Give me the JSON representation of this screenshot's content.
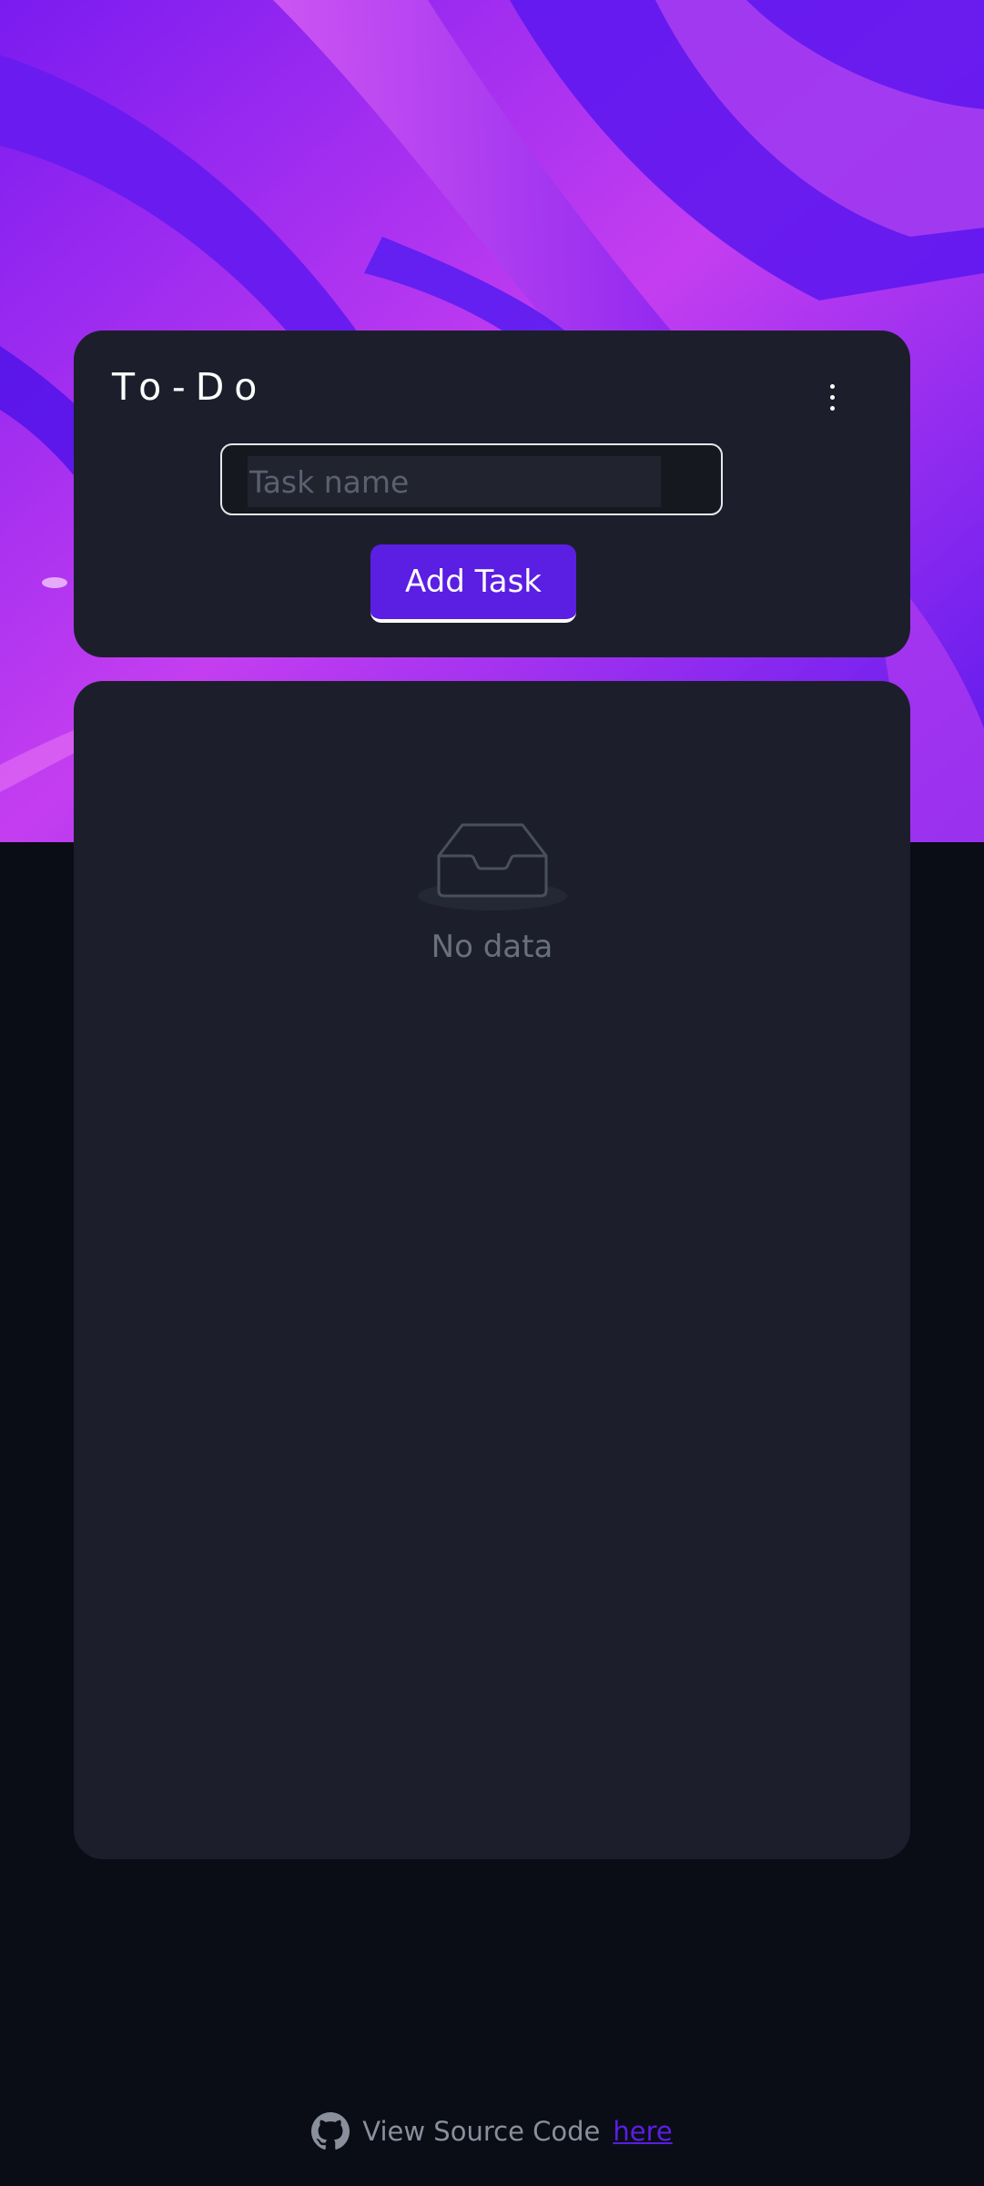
{
  "app": {
    "title": "To-Do",
    "menu_icon": "more-vertical-icon"
  },
  "form": {
    "task_placeholder": "Task name",
    "task_value": "",
    "add_button_label": "Add Task"
  },
  "list": {
    "items": [],
    "empty_icon": "empty-inbox-icon",
    "empty_text": "No data"
  },
  "footer": {
    "icon": "github-icon",
    "text": "View Source Code",
    "link_label": "here"
  },
  "colors": {
    "accent": "#5b1ee3",
    "card_bg": "#1c1f2b",
    "page_bg": "#0a0d16",
    "hero_primary": "#5b16ef",
    "hero_highlight": "#d14ef0"
  }
}
